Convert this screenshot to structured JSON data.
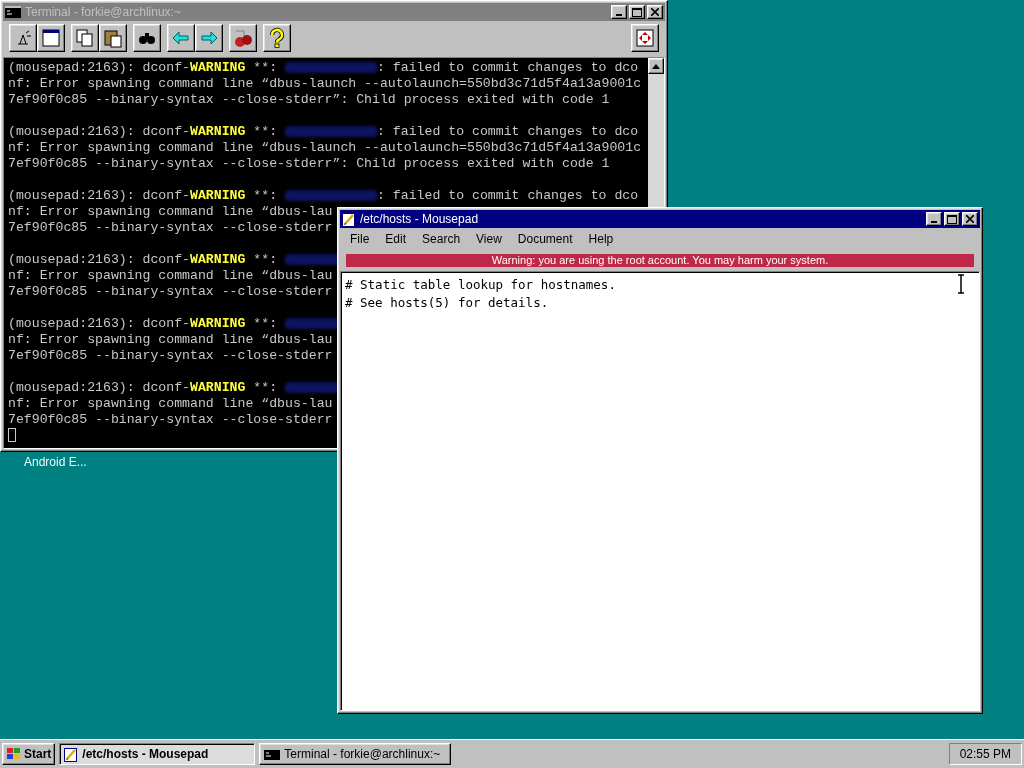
{
  "desktop_icons": [
    {
      "label": "Android E..."
    }
  ],
  "terminal": {
    "title": "Terminal - forkie@archlinux:~",
    "active": false,
    "blocks": [
      {
        "lines": [
          [
            {
              "kind": "plain",
              "text": "(mousepad:2163): dconf-"
            },
            {
              "kind": "warning",
              "text": "WARNING"
            },
            {
              "kind": "plain",
              "text": " **: "
            },
            {
              "kind": "blurred"
            },
            {
              "kind": "plain",
              "text": ": failed to commit changes to dco"
            }
          ],
          [
            {
              "kind": "plain",
              "text": "nf: Error spawning command line “dbus-launch --autolaunch=550bd3c71d5f4a13a9001c"
            }
          ],
          [
            {
              "kind": "plain",
              "text": "7ef90f0c85 --binary-syntax --close-stderr”: Child process exited with code 1"
            }
          ]
        ]
      },
      {
        "lines": [
          [
            {
              "kind": "plain",
              "text": "(mousepad:2163): dconf-"
            },
            {
              "kind": "warning",
              "text": "WARNING"
            },
            {
              "kind": "plain",
              "text": " **: "
            },
            {
              "kind": "blurred"
            },
            {
              "kind": "plain",
              "text": ": failed to commit changes to dco"
            }
          ],
          [
            {
              "kind": "plain",
              "text": "nf: Error spawning command line “dbus-launch --autolaunch=550bd3c71d5f4a13a9001c"
            }
          ],
          [
            {
              "kind": "plain",
              "text": "7ef90f0c85 --binary-syntax --close-stderr”: Child process exited with code 1"
            }
          ]
        ]
      },
      {
        "lines": [
          [
            {
              "kind": "plain",
              "text": "(mousepad:2163): dconf-"
            },
            {
              "kind": "warning",
              "text": "WARNING"
            },
            {
              "kind": "plain",
              "text": " **: "
            },
            {
              "kind": "blurred"
            },
            {
              "kind": "plain",
              "text": ": failed to commit changes to dco"
            }
          ],
          [
            {
              "kind": "plain",
              "text": "nf: Error spawning command line “dbus-lau"
            }
          ],
          [
            {
              "kind": "plain",
              "text": "7ef90f0c85 --binary-syntax --close-stderr"
            }
          ]
        ]
      },
      {
        "lines": [
          [
            {
              "kind": "plain",
              "text": "(mousepad:2163): dconf-"
            },
            {
              "kind": "warning",
              "text": "WARNING"
            },
            {
              "kind": "plain",
              "text": " **: "
            },
            {
              "kind": "blurred"
            }
          ],
          [
            {
              "kind": "plain",
              "text": "nf: Error spawning command line “dbus-lau"
            }
          ],
          [
            {
              "kind": "plain",
              "text": "7ef90f0c85 --binary-syntax --close-stderr"
            }
          ]
        ]
      },
      {
        "lines": [
          [
            {
              "kind": "plain",
              "text": "(mousepad:2163): dconf-"
            },
            {
              "kind": "warning",
              "text": "WARNING"
            },
            {
              "kind": "plain",
              "text": " **: "
            },
            {
              "kind": "blurred"
            }
          ],
          [
            {
              "kind": "plain",
              "text": "nf: Error spawning command line “dbus-lau"
            }
          ],
          [
            {
              "kind": "plain",
              "text": "7ef90f0c85 --binary-syntax --close-stderr"
            }
          ]
        ]
      },
      {
        "lines": [
          [
            {
              "kind": "plain",
              "text": "(mousepad:2163): dconf-"
            },
            {
              "kind": "warning",
              "text": "WARNING"
            },
            {
              "kind": "plain",
              "text": " **: "
            },
            {
              "kind": "blurred"
            }
          ],
          [
            {
              "kind": "plain",
              "text": "nf: Error spawning command line “dbus-lau"
            }
          ],
          [
            {
              "kind": "plain",
              "text": "7ef90f0c85 --binary-syntax --close-stderr"
            }
          ]
        ]
      }
    ]
  },
  "mousepad": {
    "title": "/etc/hosts - Mousepad",
    "active": true,
    "menu": [
      "File",
      "Edit",
      "Search",
      "View",
      "Document",
      "Help"
    ],
    "warning": "Warning: you are using the root account. You may harm your system.",
    "lines": [
      "# Static table lookup for hostnames.",
      "# See hosts(5) for details."
    ]
  },
  "taskbar": {
    "start": "Start",
    "tasks": [
      {
        "label": "/etc/hosts - Mousepad",
        "kind": "mousepad",
        "selected": true
      },
      {
        "label": "Terminal - forkie@archlinux:~",
        "kind": "terminal",
        "selected": false
      }
    ],
    "clock": "02:55 PM"
  }
}
